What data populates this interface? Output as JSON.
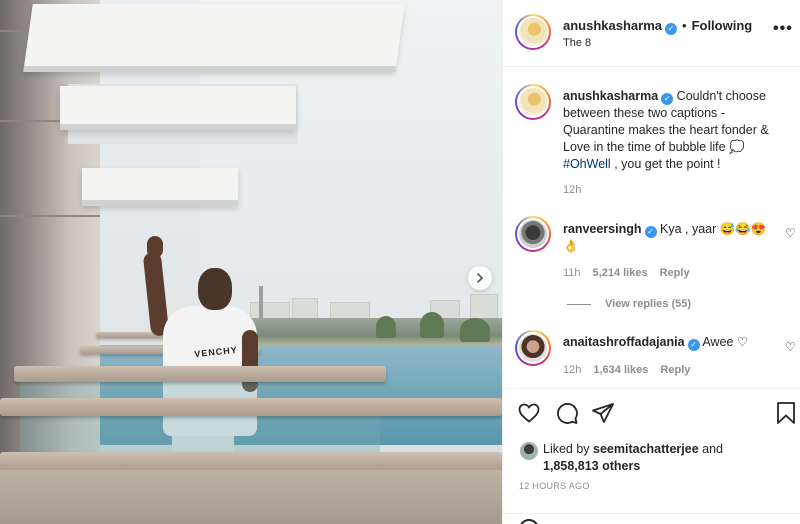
{
  "post": {
    "image_alt": "",
    "shirt_text": "VENCHY"
  },
  "header": {
    "username": "anushkasharma",
    "follow_state": "Following",
    "location": "The 8",
    "more": "•••"
  },
  "caption": {
    "username": "anushkasharma",
    "text": "Couldn't choose between these two captions - Quarantine makes the heart fonder & Love in the time of bubble life 💭",
    "hashtag": "#OhWell",
    "text_after": " , you get the point !",
    "time": "12h"
  },
  "comments": [
    {
      "username": "ranveersingh",
      "text": "Kya , yaar 😅😂😍 👌",
      "time": "11h",
      "likes": "5,214 likes",
      "reply": "Reply"
    },
    {
      "username": "anaitashroffadajania",
      "text": "Awee ♡",
      "time": "12h",
      "likes": "1,634 likes",
      "reply": "Reply"
    }
  ],
  "view_replies": "View replies (55)",
  "likes": {
    "prefix": "Liked by ",
    "user": "seemitachatterjee",
    "and": " and",
    "others": "1,858,813 others"
  },
  "timestamp": "12 HOURS AGO",
  "colors": {
    "verified": "#3897f0",
    "hashtag": "#00376b",
    "muted": "#8e8e8e"
  },
  "icons": {
    "like": "heart-icon",
    "comment": "comment-icon",
    "share": "send-icon",
    "save": "bookmark-icon",
    "next": "chevron-right-icon"
  }
}
